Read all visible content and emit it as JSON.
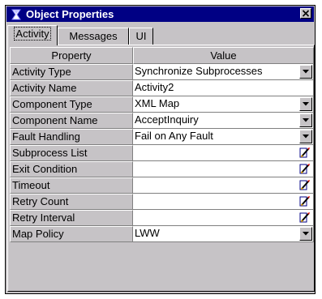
{
  "window": {
    "title": "Object Properties"
  },
  "tabs": [
    {
      "label": "Activity",
      "active": true
    },
    {
      "label": "Messages",
      "active": false
    },
    {
      "label": "UI",
      "active": false
    }
  ],
  "grid": {
    "header_property": "Property",
    "header_value": "Value",
    "rows": [
      {
        "property": "Activity Type",
        "value": "Synchronize Subprocesses",
        "control": "dropdown"
      },
      {
        "property": "Activity Name",
        "value": "Activity2",
        "control": "none"
      },
      {
        "property": "Component Type",
        "value": "XML Map",
        "control": "dropdown"
      },
      {
        "property": "Component Name",
        "value": "AcceptInquiry",
        "control": "dropdown"
      },
      {
        "property": "Fault Handling",
        "value": "Fail on Any Fault",
        "control": "dropdown"
      },
      {
        "property": "Subprocess List",
        "value": "",
        "control": "editor"
      },
      {
        "property": "Exit Condition",
        "value": "",
        "control": "editor"
      },
      {
        "property": "Timeout",
        "value": "",
        "control": "editor"
      },
      {
        "property": "Retry Count",
        "value": "",
        "control": "editor"
      },
      {
        "property": "Retry Interval",
        "value": "",
        "control": "editor"
      },
      {
        "property": "Map Policy",
        "value": "LWW",
        "control": "dropdown"
      }
    ]
  },
  "colors": {
    "titlebar": "#000084",
    "face": "#c6c3c6"
  },
  "icons": {
    "title": "properties-icon",
    "close": "close-icon",
    "dropdown": "chevron-down-icon",
    "editor": "edit-pencil-icon"
  }
}
